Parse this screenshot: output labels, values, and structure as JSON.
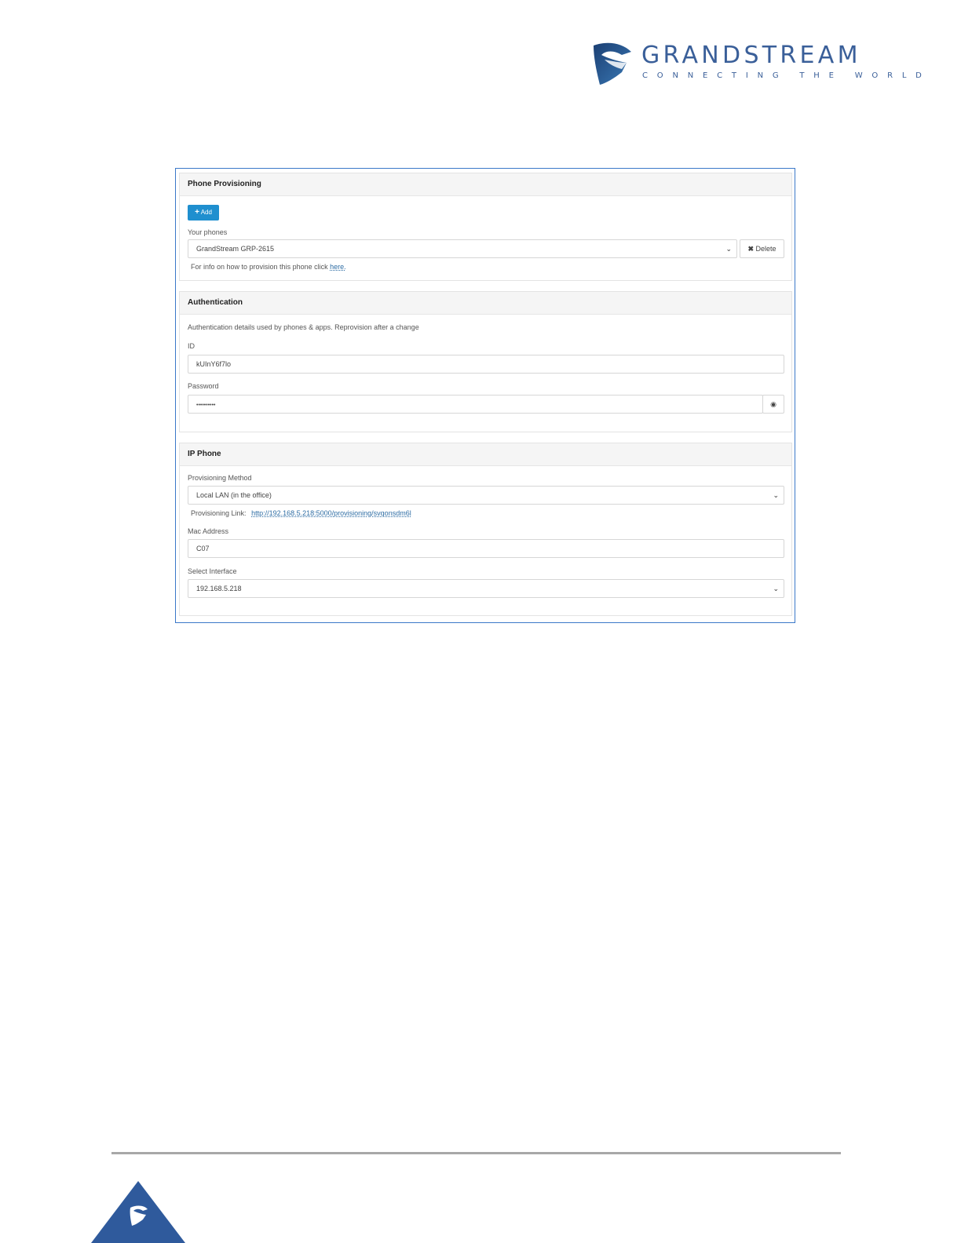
{
  "brand": {
    "name": "GRANDSTREAM",
    "tagline": "CONNECTING THE WORLD",
    "colors": {
      "primary": "#3a5f99",
      "accent_button": "#1f8fcf",
      "frame_border": "#3b78c9"
    }
  },
  "phone_provisioning": {
    "title": "Phone Provisioning",
    "add_label": "Add",
    "your_phones_label": "Your phones",
    "selected_phone": "GrandStream GRP-2615",
    "delete_label": "Delete",
    "info_text": "For info on how to provision this phone click",
    "info_link": "here."
  },
  "authentication": {
    "title": "Authentication",
    "description": "Authentication details used by phones & apps. Reprovision after a change",
    "id_label": "ID",
    "id_value": "kUInY6f7lo",
    "password_label": "Password",
    "password_value": "••••••••••"
  },
  "ip_phone": {
    "title": "IP Phone",
    "method_label": "Provisioning Method",
    "method_value": "Local LAN (in the office)",
    "link_label": "Provisioning Link:",
    "link_value": "http://192.168.5.218:5000/provisioning/svqonsdm6l",
    "mac_label": "Mac Address",
    "mac_value": "C07",
    "interface_label": "Select Interface",
    "interface_value": "192.168.5.218"
  },
  "icons": [
    "grandstream-logo-icon",
    "plus-icon",
    "chevron-down-icon",
    "close-icon",
    "eye-icon",
    "grandstream-footer-icon"
  ]
}
